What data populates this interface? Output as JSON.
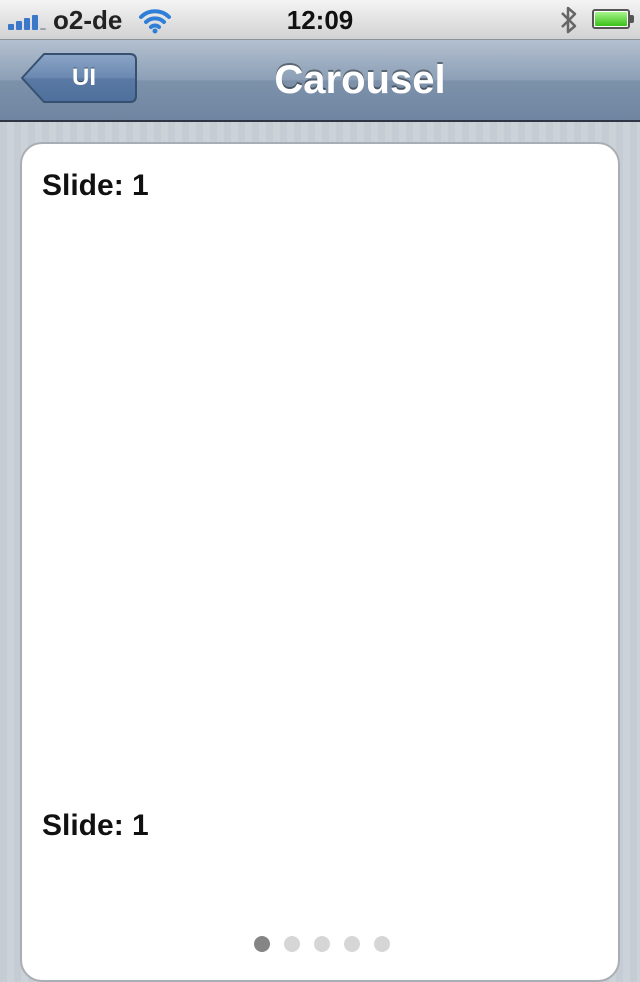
{
  "status_bar": {
    "carrier": "o2-de",
    "time": "12:09",
    "signal_bars": 4
  },
  "nav": {
    "back_label": "UI",
    "title": "Carousel"
  },
  "carousel": {
    "slide_title_top": "Slide: 1",
    "slide_title_bottom": "Slide: 1",
    "page_count": 5,
    "current_page": 1
  },
  "colors": {
    "nav_bar": "#7d91aa",
    "back_button": "#5e7ea9",
    "active_dot": "#858585",
    "inactive_dot": "#d6d6d6"
  }
}
